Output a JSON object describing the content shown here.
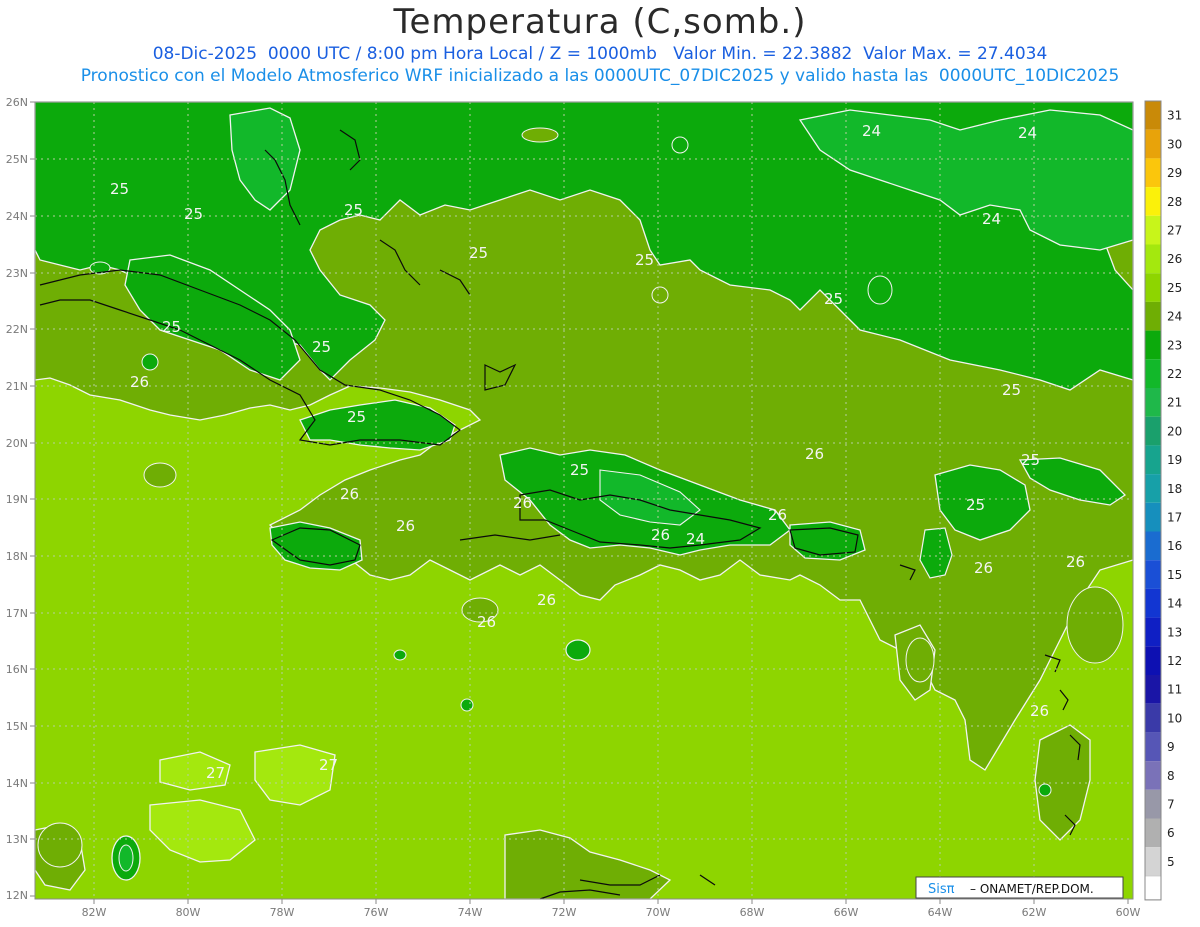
{
  "header": {
    "title": "Temperatura (C,somb.)",
    "subtitle_line1": "08-Dic-2025  0000 UTC / 8:00 pm Hora Local / Z = 1000mb   Valor Min. = 22.3882  Valor Max. = 27.4034",
    "subtitle_line2": "Pronostico con el Modelo Atmosferico WRF inicializado a las 0000UTC_07DIC2025 y valido hasta las  0000UTC_10DIC2025"
  },
  "map": {
    "lat_labels": [
      "26N",
      "25N",
      "24N",
      "23N",
      "22N",
      "21N",
      "20N",
      "19N",
      "18N",
      "17N",
      "16N",
      "15N",
      "14N",
      "13N",
      "12N"
    ],
    "lon_labels": [
      "82W",
      "80W",
      "78W",
      "76W",
      "74W",
      "72W",
      "70W",
      "68W",
      "66W",
      "64W",
      "62W",
      "60W"
    ],
    "contour_labels": [
      {
        "text": "24"
      },
      {
        "text": "24"
      },
      {
        "text": "24"
      },
      {
        "text": "25"
      },
      {
        "text": "25"
      },
      {
        "text": "25"
      },
      {
        "text": "25"
      },
      {
        "text": "25"
      },
      {
        "text": "25"
      },
      {
        "text": "25"
      },
      {
        "text": "25"
      },
      {
        "text": "25"
      },
      {
        "text": "25"
      },
      {
        "text": "25"
      },
      {
        "text": "25"
      },
      {
        "text": "25"
      },
      {
        "text": "26"
      },
      {
        "text": "26"
      },
      {
        "text": "26"
      },
      {
        "text": "26"
      },
      {
        "text": "26"
      },
      {
        "text": "26"
      },
      {
        "text": "26"
      },
      {
        "text": "26"
      },
      {
        "text": "26"
      },
      {
        "text": "26"
      },
      {
        "text": "26"
      },
      {
        "text": "26"
      },
      {
        "text": "24"
      },
      {
        "text": "27"
      },
      {
        "text": "27"
      }
    ],
    "land_color": "#0b0b0b",
    "grid_color": "#b6cfa0"
  },
  "colorbar": {
    "levels": [
      {
        "label": "31",
        "color": "#c98a08"
      },
      {
        "label": "30",
        "color": "#e8a30a"
      },
      {
        "label": "29",
        "color": "#fbc60c"
      },
      {
        "label": "28",
        "color": "#fbf10a"
      },
      {
        "label": "27",
        "color": "#c8f51a"
      },
      {
        "label": "26",
        "color": "#a4e80e"
      },
      {
        "label": "25",
        "color": "#8ed500"
      },
      {
        "label": "24",
        "color": "#6fae04"
      },
      {
        "label": "23",
        "color": "#0caa0c"
      },
      {
        "label": "22",
        "color": "#12b82a"
      },
      {
        "label": "21",
        "color": "#1fb84a"
      },
      {
        "label": "20",
        "color": "#1aa06c"
      },
      {
        "label": "19",
        "color": "#17a48e"
      },
      {
        "label": "18",
        "color": "#17a0a8"
      },
      {
        "label": "17",
        "color": "#168fbd"
      },
      {
        "label": "16",
        "color": "#1a6cd0"
      },
      {
        "label": "15",
        "color": "#1a4fd6"
      },
      {
        "label": "14",
        "color": "#1236d2"
      },
      {
        "label": "13",
        "color": "#0f1fc4"
      },
      {
        "label": "12",
        "color": "#0d10b2"
      },
      {
        "label": "11",
        "color": "#1a15a6"
      },
      {
        "label": "10",
        "color": "#3a3aa8"
      },
      {
        "label": "9",
        "color": "#5656b6"
      },
      {
        "label": "8",
        "color": "#7a72b8"
      },
      {
        "label": "7",
        "color": "#9898a8"
      },
      {
        "label": "6",
        "color": "#b0b0b0"
      },
      {
        "label": "5",
        "color": "#d4d4d4"
      }
    ]
  },
  "credit": {
    "logo_text": "Sisπ",
    "text": "– ONAMET/REP.DOM."
  }
}
